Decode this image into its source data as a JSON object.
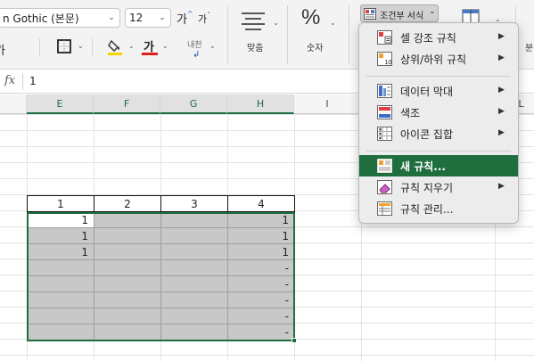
{
  "ribbon": {
    "font_name": "n Gothic (본문)",
    "font_size": "12",
    "grow_font_glyph": "가",
    "shrink_font_glyph": "가",
    "font_color_glyph": "가",
    "wrap_text_label": "내천",
    "alignment_label": "맞춤",
    "number_label": "숫자",
    "percent_glyph": "%",
    "conditional_format_label": "조건부 서식",
    "left_edge_glyph": "가",
    "right_edge_label": "분"
  },
  "formula_bar": {
    "fx": "fx",
    "value": "1"
  },
  "columns": [
    "E",
    "F",
    "G",
    "H",
    "I",
    "L"
  ],
  "table": {
    "header": [
      "1",
      "2",
      "3",
      "4"
    ],
    "rows": [
      [
        "1",
        "",
        "",
        "1"
      ],
      [
        "1",
        "",
        "",
        "1"
      ],
      [
        "1",
        "",
        "",
        "1"
      ],
      [
        "",
        "",
        "",
        "-"
      ],
      [
        "",
        "",
        "",
        "-"
      ],
      [
        "",
        "",
        "",
        "-"
      ],
      [
        "",
        "",
        "",
        "-"
      ],
      [
        "",
        "",
        "",
        "-"
      ]
    ]
  },
  "menu": {
    "items": [
      {
        "label": "셀 강조 규칙",
        "submenu": "▶"
      },
      {
        "label": "상위/하위 규칙",
        "submenu": "▶"
      },
      {
        "label": "데이터 막대",
        "submenu": "▶"
      },
      {
        "label": "색조",
        "submenu": "▶"
      },
      {
        "label": "아이콘 집합",
        "submenu": "▶"
      },
      {
        "label": "새 규칙...",
        "submenu": ""
      },
      {
        "label": "규칙 지우기",
        "submenu": "▶"
      },
      {
        "label": "규칙 관리...",
        "submenu": ""
      }
    ]
  },
  "colors": {
    "accent": "#1e6e3e",
    "shade": "#c8c8c8",
    "highlight_yellow": "#f5d400",
    "font_red": "#e02020"
  }
}
